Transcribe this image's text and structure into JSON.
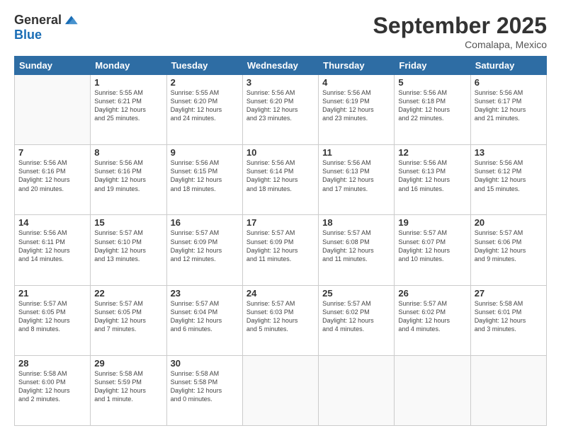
{
  "logo": {
    "general": "General",
    "blue": "Blue"
  },
  "title": "September 2025",
  "subtitle": "Comalapa, Mexico",
  "days_header": [
    "Sunday",
    "Monday",
    "Tuesday",
    "Wednesday",
    "Thursday",
    "Friday",
    "Saturday"
  ],
  "weeks": [
    [
      {
        "day": "",
        "info": ""
      },
      {
        "day": "1",
        "info": "Sunrise: 5:55 AM\nSunset: 6:21 PM\nDaylight: 12 hours\nand 25 minutes."
      },
      {
        "day": "2",
        "info": "Sunrise: 5:55 AM\nSunset: 6:20 PM\nDaylight: 12 hours\nand 24 minutes."
      },
      {
        "day": "3",
        "info": "Sunrise: 5:56 AM\nSunset: 6:20 PM\nDaylight: 12 hours\nand 23 minutes."
      },
      {
        "day": "4",
        "info": "Sunrise: 5:56 AM\nSunset: 6:19 PM\nDaylight: 12 hours\nand 23 minutes."
      },
      {
        "day": "5",
        "info": "Sunrise: 5:56 AM\nSunset: 6:18 PM\nDaylight: 12 hours\nand 22 minutes."
      },
      {
        "day": "6",
        "info": "Sunrise: 5:56 AM\nSunset: 6:17 PM\nDaylight: 12 hours\nand 21 minutes."
      }
    ],
    [
      {
        "day": "7",
        "info": "Sunrise: 5:56 AM\nSunset: 6:16 PM\nDaylight: 12 hours\nand 20 minutes."
      },
      {
        "day": "8",
        "info": "Sunrise: 5:56 AM\nSunset: 6:16 PM\nDaylight: 12 hours\nand 19 minutes."
      },
      {
        "day": "9",
        "info": "Sunrise: 5:56 AM\nSunset: 6:15 PM\nDaylight: 12 hours\nand 18 minutes."
      },
      {
        "day": "10",
        "info": "Sunrise: 5:56 AM\nSunset: 6:14 PM\nDaylight: 12 hours\nand 18 minutes."
      },
      {
        "day": "11",
        "info": "Sunrise: 5:56 AM\nSunset: 6:13 PM\nDaylight: 12 hours\nand 17 minutes."
      },
      {
        "day": "12",
        "info": "Sunrise: 5:56 AM\nSunset: 6:13 PM\nDaylight: 12 hours\nand 16 minutes."
      },
      {
        "day": "13",
        "info": "Sunrise: 5:56 AM\nSunset: 6:12 PM\nDaylight: 12 hours\nand 15 minutes."
      }
    ],
    [
      {
        "day": "14",
        "info": "Sunrise: 5:56 AM\nSunset: 6:11 PM\nDaylight: 12 hours\nand 14 minutes."
      },
      {
        "day": "15",
        "info": "Sunrise: 5:57 AM\nSunset: 6:10 PM\nDaylight: 12 hours\nand 13 minutes."
      },
      {
        "day": "16",
        "info": "Sunrise: 5:57 AM\nSunset: 6:09 PM\nDaylight: 12 hours\nand 12 minutes."
      },
      {
        "day": "17",
        "info": "Sunrise: 5:57 AM\nSunset: 6:09 PM\nDaylight: 12 hours\nand 11 minutes."
      },
      {
        "day": "18",
        "info": "Sunrise: 5:57 AM\nSunset: 6:08 PM\nDaylight: 12 hours\nand 11 minutes."
      },
      {
        "day": "19",
        "info": "Sunrise: 5:57 AM\nSunset: 6:07 PM\nDaylight: 12 hours\nand 10 minutes."
      },
      {
        "day": "20",
        "info": "Sunrise: 5:57 AM\nSunset: 6:06 PM\nDaylight: 12 hours\nand 9 minutes."
      }
    ],
    [
      {
        "day": "21",
        "info": "Sunrise: 5:57 AM\nSunset: 6:05 PM\nDaylight: 12 hours\nand 8 minutes."
      },
      {
        "day": "22",
        "info": "Sunrise: 5:57 AM\nSunset: 6:05 PM\nDaylight: 12 hours\nand 7 minutes."
      },
      {
        "day": "23",
        "info": "Sunrise: 5:57 AM\nSunset: 6:04 PM\nDaylight: 12 hours\nand 6 minutes."
      },
      {
        "day": "24",
        "info": "Sunrise: 5:57 AM\nSunset: 6:03 PM\nDaylight: 12 hours\nand 5 minutes."
      },
      {
        "day": "25",
        "info": "Sunrise: 5:57 AM\nSunset: 6:02 PM\nDaylight: 12 hours\nand 4 minutes."
      },
      {
        "day": "26",
        "info": "Sunrise: 5:57 AM\nSunset: 6:02 PM\nDaylight: 12 hours\nand 4 minutes."
      },
      {
        "day": "27",
        "info": "Sunrise: 5:58 AM\nSunset: 6:01 PM\nDaylight: 12 hours\nand 3 minutes."
      }
    ],
    [
      {
        "day": "28",
        "info": "Sunrise: 5:58 AM\nSunset: 6:00 PM\nDaylight: 12 hours\nand 2 minutes."
      },
      {
        "day": "29",
        "info": "Sunrise: 5:58 AM\nSunset: 5:59 PM\nDaylight: 12 hours\nand 1 minute."
      },
      {
        "day": "30",
        "info": "Sunrise: 5:58 AM\nSunset: 5:58 PM\nDaylight: 12 hours\nand 0 minutes."
      },
      {
        "day": "",
        "info": ""
      },
      {
        "day": "",
        "info": ""
      },
      {
        "day": "",
        "info": ""
      },
      {
        "day": "",
        "info": ""
      }
    ]
  ]
}
